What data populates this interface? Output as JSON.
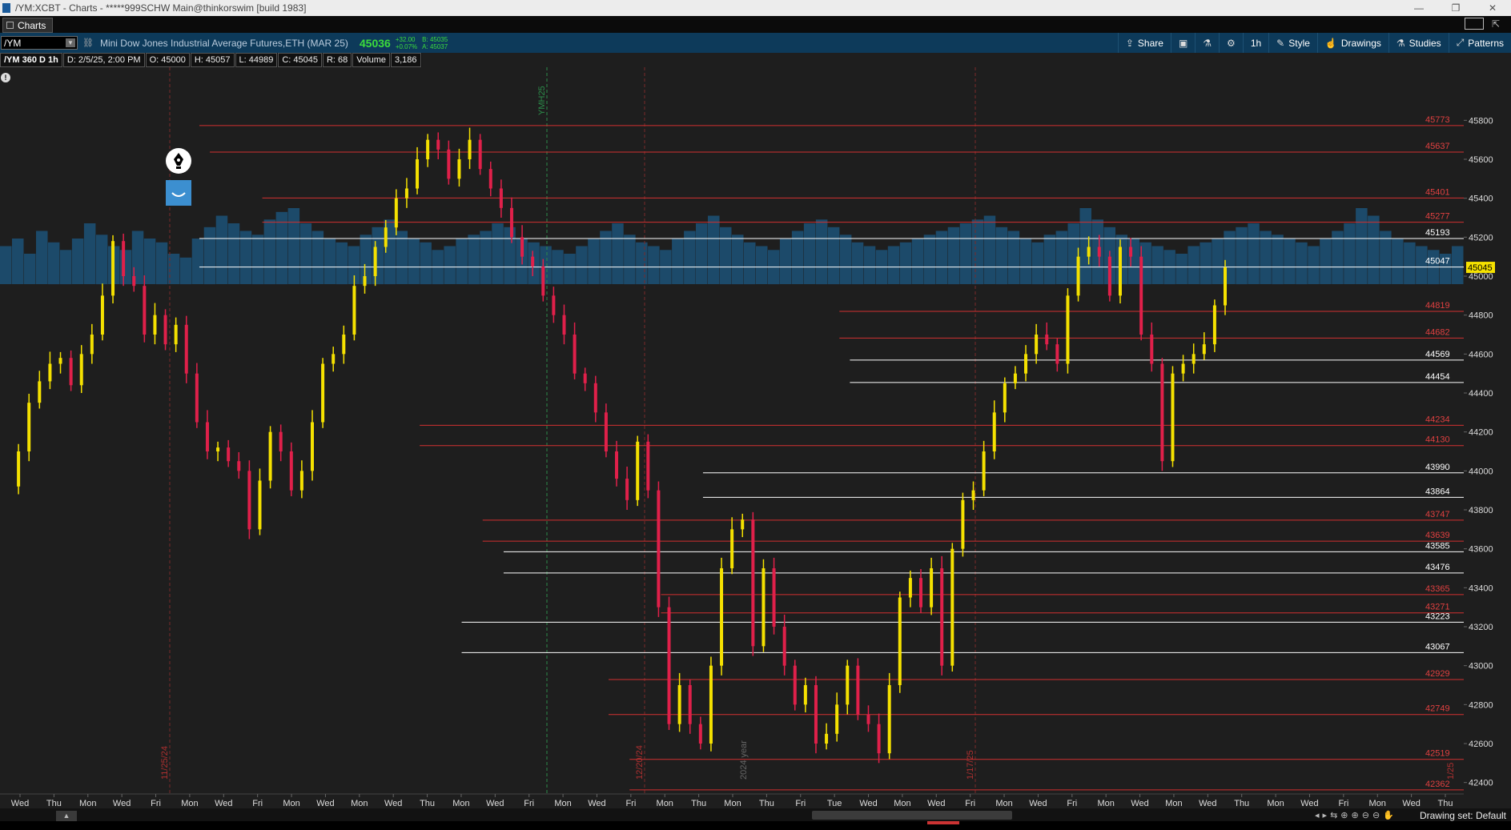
{
  "window": {
    "title": "/YM:XCBT - Charts - *****999SCHW Main@thinkorswim [build 1983]",
    "controls": [
      "—",
      "❐",
      "✕"
    ]
  },
  "tabbar": {
    "tab_label": "Charts"
  },
  "toolbar": {
    "symbol": "/YM",
    "description": "Mini Dow Jones Industrial Average Futures,ETH (MAR 25)",
    "last": "45036",
    "change": "+32.00",
    "change_pct": "+0.07%",
    "bid": "B: 45035",
    "ask": "A: 45037",
    "buttons": [
      {
        "label": "Share",
        "icon": "share-icon"
      },
      {
        "label": "",
        "icon": "screenshot-icon"
      },
      {
        "label": "",
        "icon": "flask-icon"
      },
      {
        "label": "",
        "icon": "gear-icon"
      },
      {
        "label": "1h",
        "icon": ""
      },
      {
        "label": "Style",
        "icon": "style-icon"
      },
      {
        "label": "Drawings",
        "icon": "drawings-icon"
      },
      {
        "label": "Studies",
        "icon": "studies-icon"
      },
      {
        "label": "Patterns",
        "icon": "patterns-icon"
      }
    ]
  },
  "infobar": {
    "name": "/YM 360 D 1h",
    "date": "D: 2/5/25, 2:00 PM",
    "open": "O: 45000",
    "high": "H: 45057",
    "low": "L: 44989",
    "close": "C: 45045",
    "range": "R: 68",
    "volume_label": "Volume",
    "volume_value": "3,186"
  },
  "chart_data": {
    "type": "line",
    "title": "",
    "ylim": [
      42300,
      45900
    ],
    "y_ticks": [
      45800,
      45600,
      45400,
      45200,
      45000,
      44800,
      44600,
      44400,
      44200,
      44000,
      43800,
      43600,
      43400,
      43200,
      43000,
      42800,
      42600,
      42400
    ],
    "x_ticks": [
      "Wed",
      "Thu",
      "Mon",
      "Wed",
      "Fri",
      "Mon",
      "Wed",
      "Fri",
      "Mon",
      "Wed",
      "Mon",
      "Wed",
      "Thu",
      "Mon",
      "Wed",
      "Fri",
      "Mon",
      "Wed",
      "Fri",
      "Mon",
      "Thu",
      "Mon",
      "Thu",
      "Fri",
      "Tue",
      "Wed",
      "Mon",
      "Wed",
      "Fri",
      "Mon",
      "Wed",
      "Fri",
      "Mon",
      "Wed",
      "Mon",
      "Wed",
      "Thu",
      "Mon",
      "Wed",
      "Fri",
      "Mon",
      "Wed",
      "Thu"
    ],
    "current_price": 45045,
    "current_price_color": "#f5e100",
    "level_lines": [
      {
        "value": 45773,
        "color": "#d23030",
        "start_index": 19
      },
      {
        "value": 45637,
        "color": "#d23030",
        "start_index": 20
      },
      {
        "value": 45401,
        "color": "#d23030",
        "start_index": 25
      },
      {
        "value": 45277,
        "color": "#d23030",
        "start_index": 25
      },
      {
        "value": 45193,
        "color": "#ffffff",
        "start_index": 19
      },
      {
        "value": 45047,
        "color": "#ffffff",
        "start_index": 19
      },
      {
        "value": 44819,
        "color": "#d23030",
        "start_index": 80
      },
      {
        "value": 44682,
        "color": "#d23030",
        "start_index": 80
      },
      {
        "value": 44569,
        "color": "#ffffff",
        "start_index": 81
      },
      {
        "value": 44454,
        "color": "#ffffff",
        "start_index": 81
      },
      {
        "value": 44234,
        "color": "#d23030",
        "start_index": 40
      },
      {
        "value": 44130,
        "color": "#d23030",
        "start_index": 40
      },
      {
        "value": 43990,
        "color": "#ffffff",
        "start_index": 67
      },
      {
        "value": 43864,
        "color": "#ffffff",
        "start_index": 67
      },
      {
        "value": 43747,
        "color": "#d23030",
        "start_index": 46
      },
      {
        "value": 43639,
        "color": "#d23030",
        "start_index": 46
      },
      {
        "value": 43585,
        "color": "#ffffff",
        "start_index": 48
      },
      {
        "value": 43476,
        "color": "#ffffff",
        "start_index": 48
      },
      {
        "value": 43365,
        "color": "#d23030",
        "start_index": 63
      },
      {
        "value": 43271,
        "color": "#d23030",
        "start_index": 63
      },
      {
        "value": 43223,
        "color": "#ffffff",
        "start_index": 44
      },
      {
        "value": 43067,
        "color": "#ffffff",
        "start_index": 44
      },
      {
        "value": 42929,
        "color": "#d23030",
        "start_index": 58
      },
      {
        "value": 42749,
        "color": "#d23030",
        "start_index": 58
      },
      {
        "value": 42519,
        "color": "#d23030",
        "start_index": 60
      },
      {
        "value": 42362,
        "color": "#d23030",
        "start_index": 60
      }
    ],
    "price_path": [
      43920,
      44100,
      44350,
      44460,
      44550,
      44580,
      44440,
      44600,
      44700,
      44900,
      45180,
      45000,
      44950,
      44700,
      44800,
      44650,
      44750,
      44500,
      44250,
      44100,
      44120,
      44050,
      44000,
      43700,
      43950,
      44200,
      44100,
      43900,
      44000,
      44250,
      44550,
      44600,
      44700,
      44950,
      45000,
      45150,
      45250,
      45400,
      45450,
      45600,
      45700,
      45650,
      45500,
      45600,
      45700,
      45550,
      45450,
      45350,
      45200,
      45100,
      45050,
      44900,
      44800,
      44700,
      44500,
      44450,
      44300,
      44100,
      43960,
      43850,
      44150,
      43900,
      43300,
      42700,
      42900,
      42700,
      42600,
      43000,
      43500,
      43700,
      43750,
      43100,
      43500,
      43200,
      43000,
      42800,
      42900,
      42600,
      42650,
      42800,
      43000,
      42750,
      42700,
      42550,
      42900,
      43350,
      43450,
      43300,
      43500,
      43000,
      43600,
      43850,
      43900,
      44100,
      44300,
      44450,
      44500,
      44600,
      44700,
      44650,
      44550,
      44900,
      45100,
      45150,
      45100,
      44900,
      45150,
      45100,
      44700,
      44550,
      44050,
      44500,
      44550,
      44600,
      44650,
      44850,
      45045
    ],
    "volume_profile": [
      50,
      60,
      40,
      70,
      55,
      45,
      60,
      80,
      65,
      50,
      45,
      70,
      60,
      55,
      40,
      35,
      60,
      75,
      90,
      80,
      70,
      65,
      85,
      95,
      100,
      80,
      70,
      60,
      55,
      50,
      65,
      75,
      85,
      70,
      60,
      55,
      45,
      50,
      60,
      65,
      70,
      80,
      75,
      60,
      55,
      50,
      45,
      40,
      50,
      60,
      70,
      80,
      65,
      55,
      50,
      45,
      60,
      70,
      80,
      90,
      75,
      65,
      55,
      50,
      45,
      60,
      70,
      80,
      85,
      75,
      65,
      55,
      50,
      45,
      50,
      55,
      60,
      65,
      70,
      75,
      80,
      85,
      90,
      75,
      70,
      60,
      55,
      65,
      70,
      80,
      100,
      85,
      75,
      65,
      60,
      55,
      50,
      45,
      40,
      50,
      55,
      60,
      70,
      75,
      80,
      70,
      65,
      60,
      55,
      50,
      60,
      70,
      80,
      100,
      90,
      70,
      60,
      55,
      50,
      45,
      40,
      50
    ],
    "period_labels": [
      "11/25/24",
      "YMH25",
      "12/20/24",
      "2024 year",
      "1/17/25",
      "1/25"
    ],
    "grid": false
  },
  "scrollbar": {
    "home_label": "▲",
    "drawing_set": "Drawing set: Default",
    "controls": [
      "◂",
      "▸",
      "⇆",
      "⊕",
      "⊕",
      "⊖",
      "⊖",
      "✋"
    ]
  },
  "badges": {
    "info": "!"
  }
}
